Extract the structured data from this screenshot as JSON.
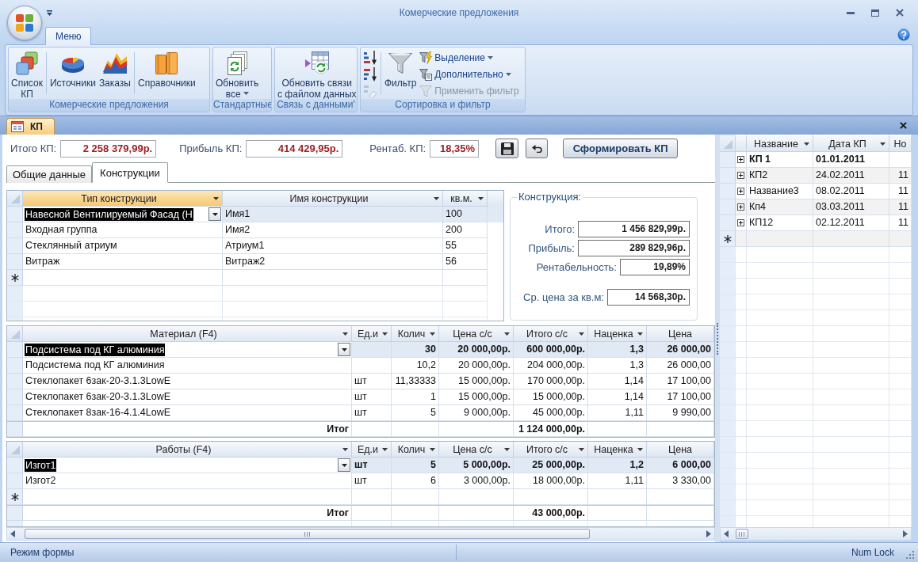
{
  "window": {
    "title": "Комерческие предложения"
  },
  "ribbon": {
    "tabs": [
      {
        "label": "Меню",
        "selected": true
      }
    ],
    "groups": [
      {
        "label": "Комерческие предложения",
        "buttons": [
          {
            "lines": [
              "Список",
              "КП"
            ],
            "dropdown": false,
            "separator_after": true
          },
          {
            "lines": [
              "Источники"
            ],
            "dropdown": false,
            "separator_after": false
          },
          {
            "lines": [
              "Заказы"
            ],
            "dropdown": false,
            "separator_after": true
          },
          {
            "lines": [
              "Справочники"
            ],
            "dropdown": false,
            "separator_after": false
          }
        ]
      },
      {
        "label": "Стандартные",
        "buttons": [
          {
            "lines": [
              "Обновить",
              "все"
            ],
            "dropdown": true,
            "separator_after": false
          }
        ]
      },
      {
        "label": "Связь с данными'",
        "buttons": [
          {
            "lines": [
              "Обновить связи",
              "с файлом данных"
            ],
            "dropdown": false,
            "separator_after": false
          }
        ]
      },
      {
        "label": "Сортировка и фильтр",
        "sort_buttons": [
          {
            "disabled": false
          },
          {
            "disabled": false
          },
          {
            "disabled": true
          }
        ],
        "buttons": [
          {
            "lines": [
              "Фильтр"
            ],
            "dropdown": false,
            "separator_after": false
          }
        ],
        "small_buttons": [
          {
            "label": "Выделение",
            "dropdown": true,
            "disabled": false
          },
          {
            "label": "Дополнительно",
            "dropdown": true,
            "disabled": false
          },
          {
            "label": "Применить фильтр",
            "dropdown": false,
            "disabled": true
          }
        ]
      }
    ]
  },
  "documents": {
    "tabs": [
      {
        "label": "КП",
        "selected": true
      }
    ]
  },
  "form": {
    "totals": [
      {
        "label": "Итого КП:",
        "value": "2 258 379,99р."
      },
      {
        "label": "Прибыль КП:",
        "value": "414 429,95р."
      },
      {
        "label": "Рентаб. КП:",
        "value": "18,35%"
      }
    ],
    "generate_button": "Сформировать КП",
    "tabs": [
      {
        "label": "Общие данные",
        "selected": false
      },
      {
        "label": "Конструкции",
        "selected": true
      }
    ],
    "constructions": {
      "columns": [
        {
          "label": "Тип конструкции",
          "selected": true,
          "menu": true
        },
        {
          "label": "Имя конструкции",
          "selected": false,
          "menu": true
        },
        {
          "label": "кв.м.",
          "selected": false,
          "menu": true
        }
      ],
      "rows": [
        {
          "type": "Навесной Вентилируемый Фасад (Н",
          "name": "Имя1",
          "area": "100",
          "selected": true
        },
        {
          "type": "Входная группа",
          "name": "Имя2",
          "area": "200",
          "selected": false
        },
        {
          "type": "Стеклянный атриум",
          "name": "Атриум1",
          "area": "55",
          "selected": false
        },
        {
          "type": "Витраж",
          "name": "Витраж2",
          "area": "56",
          "selected": false
        }
      ],
      "new_row": true
    },
    "summary": {
      "title": "Конструкция:",
      "fields": [
        {
          "label": "Итого:",
          "value": "1 456 829,99р."
        },
        {
          "label": "Прибыль:",
          "value": "289 829,96р."
        },
        {
          "label": "Рентабельность:",
          "value": "19,89%"
        },
        {
          "label": "Ср. цена за кв.м:",
          "value": "14 568,30р."
        }
      ]
    },
    "materials": {
      "columns": [
        {
          "label": "Материал (F4)",
          "selected": false,
          "menu": true
        },
        {
          "label": "Ед.и",
          "selected": false,
          "menu": true
        },
        {
          "label": "Колич",
          "selected": false,
          "menu": true
        },
        {
          "label": "Цена с/с",
          "selected": false,
          "menu": true
        },
        {
          "label": "Итого с/с",
          "selected": false,
          "menu": true
        },
        {
          "label": "Наценка",
          "selected": false,
          "menu": true
        },
        {
          "label": "Цена",
          "selected": false,
          "menu": false
        }
      ],
      "rows": [
        {
          "name": "Подсистема под КГ алюминия",
          "qty": "30",
          "cost_price": "20 000,00р.",
          "cost_total": "600 000,00р.",
          "markup": "1,3",
          "price": "26 000,00",
          "selected": true
        },
        {
          "name": "Подсистема под КГ алюминия",
          "qty": "10,2",
          "cost_price": "20 000,00р.",
          "cost_total": "204 000,00р.",
          "markup": "1,3",
          "price": "26 000,00",
          "selected": false
        },
        {
          "name": "Стеклопакет 6зак-20-3.1.3LowE",
          "unit": "шт",
          "qty": "11,33333",
          "cost_price": "15 000,00р.",
          "cost_total": "170 000,00р.",
          "markup": "1,14",
          "price": "17 100,00",
          "selected": false
        },
        {
          "name": "Стеклопакет 6зак-20-3.1.3LowE",
          "unit": "шт",
          "qty": "1",
          "cost_price": "15 000,00р.",
          "cost_total": "15 000,00р.",
          "markup": "1,14",
          "price": "17 100,00",
          "selected": false
        },
        {
          "name": "Стеклопакет 8зак-16-4.1.4LowE",
          "unit": "шт",
          "qty": "5",
          "cost_price": "9 000,00р.",
          "cost_total": "45 000,00р.",
          "markup": "1,11",
          "price": "9 990,00",
          "selected": false
        }
      ],
      "total": {
        "label": "Итог",
        "value": "1 124 000,00р."
      }
    },
    "works": {
      "columns": [
        {
          "label": "Работы (F4)",
          "selected": false,
          "menu": true
        },
        {
          "label": "Ед.и",
          "selected": false,
          "menu": true
        },
        {
          "label": "Колич",
          "selected": false,
          "menu": true
        },
        {
          "label": "Цена с/с",
          "selected": false,
          "menu": true
        },
        {
          "label": "Итого с/с",
          "selected": false,
          "menu": true
        },
        {
          "label": "Наценка",
          "selected": false,
          "menu": true
        },
        {
          "label": "Цена",
          "selected": false,
          "menu": false
        }
      ],
      "rows": [
        {
          "name": "Изгот1",
          "unit": "шт",
          "qty": "5",
          "cost_price": "5 000,00р.",
          "cost_total": "25 000,00р.",
          "markup": "1,2",
          "price": "6 000,00",
          "selected": true
        },
        {
          "name": "Изгот2",
          "unit": "шт",
          "qty": "6",
          "cost_price": "3 000,00р.",
          "cost_total": "18 000,00р.",
          "markup": "1,11",
          "price": "3 330,00",
          "selected": false
        }
      ],
      "new_row": true,
      "total": {
        "label": "Итог",
        "value": "43 000,00р."
      }
    }
  },
  "records": {
    "columns": [
      {
        "label": "Название",
        "selected": false,
        "menu": true
      },
      {
        "label": "Дата КП",
        "selected": false,
        "menu": true
      },
      {
        "label": "Но",
        "selected": false,
        "menu": false
      }
    ],
    "rows": [
      {
        "name": "КП 1",
        "date": "01.01.2011",
        "selected": true
      },
      {
        "name": "КП2",
        "date": "24.02.2011",
        "column_3": "11",
        "selected": false
      },
      {
        "name": "Название3",
        "date": "08.02.2011",
        "column_3": "11",
        "selected": false
      },
      {
        "name": "Кп4",
        "date": "03.03.2011",
        "column_3": "11",
        "selected": false
      },
      {
        "name": "КП12",
        "date": "02.12.2011",
        "column_3": "11",
        "selected": false
      }
    ],
    "new_row": true
  },
  "status_bar": {
    "mode": "Режим формы",
    "indicators": [
      "Num Lock"
    ]
  }
}
